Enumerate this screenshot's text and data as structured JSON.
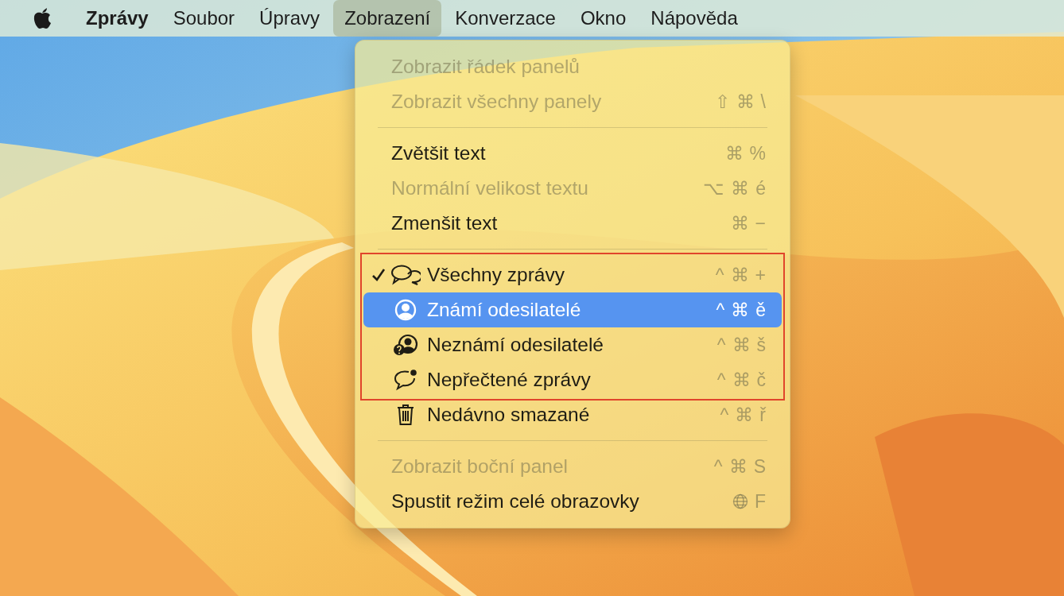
{
  "menubar": {
    "items": [
      {
        "label": "Zprávy",
        "kind": "app",
        "selected": false
      },
      {
        "label": "Soubor",
        "kind": "menu",
        "selected": false
      },
      {
        "label": "Úpravy",
        "kind": "menu",
        "selected": false
      },
      {
        "label": "Zobrazení",
        "kind": "menu",
        "selected": true
      },
      {
        "label": "Konverzace",
        "kind": "menu",
        "selected": false
      },
      {
        "label": "Okno",
        "kind": "menu",
        "selected": false
      },
      {
        "label": "Nápověda",
        "kind": "menu",
        "selected": false
      }
    ]
  },
  "menu": {
    "sections": [
      {
        "items": [
          {
            "label": "Zobrazit řádek panelů",
            "kind": "plain",
            "disabled": true,
            "checked": false,
            "selected": false
          },
          {
            "label": "Zobrazit všechny panely",
            "kind": "plain",
            "disabled": true,
            "checked": false,
            "selected": false,
            "shortcut": [
              "⇧",
              "⌘",
              "\\"
            ]
          }
        ]
      },
      {
        "items": [
          {
            "label": "Zvětšit text",
            "kind": "plain",
            "disabled": false,
            "checked": false,
            "selected": false,
            "shortcut": [
              "⌘",
              "%"
            ]
          },
          {
            "label": "Normální velikost textu",
            "kind": "plain",
            "disabled": true,
            "checked": false,
            "selected": false,
            "shortcut": [
              "⌥",
              "⌘",
              "é"
            ]
          },
          {
            "label": "Zmenšit text",
            "kind": "plain",
            "disabled": false,
            "checked": false,
            "selected": false,
            "shortcut": [
              "⌘",
              "−"
            ]
          }
        ]
      },
      {
        "outlined_items": [
          {
            "label": "Všechny zprávy",
            "kind": "bubbles",
            "disabled": false,
            "checked": true,
            "selected": false,
            "shortcut": [
              "^",
              "⌘",
              "+"
            ]
          },
          {
            "label": "Známí odesilatelé",
            "kind": "person",
            "disabled": false,
            "checked": false,
            "selected": true,
            "shortcut": [
              "^",
              "⌘",
              "ě"
            ]
          },
          {
            "label": "Neznámí odesilatelé",
            "kind": "unknown",
            "disabled": false,
            "checked": false,
            "selected": false,
            "shortcut": [
              "^",
              "⌘",
              "š"
            ]
          },
          {
            "label": "Nepřečtené zprávy",
            "kind": "unread",
            "disabled": false,
            "checked": false,
            "selected": false,
            "shortcut": [
              "^",
              "⌘",
              "č"
            ]
          }
        ],
        "items": [
          {
            "label": "Nedávno smazané",
            "kind": "trash",
            "disabled": false,
            "checked": false,
            "selected": false,
            "shortcut": [
              "^",
              "⌘",
              "ř"
            ]
          }
        ]
      },
      {
        "items": [
          {
            "label": "Zobrazit boční panel",
            "kind": "plain",
            "disabled": true,
            "checked": false,
            "selected": false,
            "shortcut": [
              "^",
              "⌘",
              "S"
            ]
          },
          {
            "label": "Spustit režim celé obrazovky",
            "kind": "plain",
            "disabled": false,
            "checked": false,
            "selected": false,
            "globe": true,
            "shortcut": [
              "F"
            ]
          }
        ]
      }
    ]
  }
}
